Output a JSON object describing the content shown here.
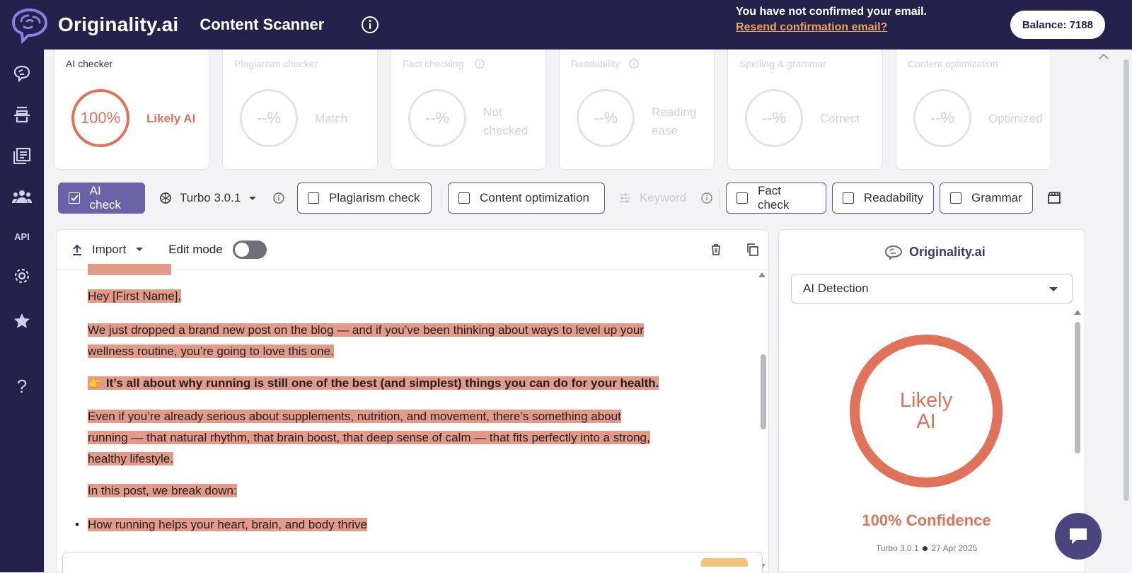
{
  "header": {
    "logo_text": "Originality.ai",
    "app_title": "Content Scanner",
    "email_notice": "You have not confirmed your email.",
    "resend_link": "Resend confirmation email?",
    "balance": "Balance: 7188"
  },
  "sidebar": {
    "items": [
      "brain-icon",
      "scanner-icon",
      "library-icon",
      "team-icon",
      "api-icon",
      "settings-icon",
      "star-icon",
      "help-icon"
    ],
    "api_label": "API",
    "help_label": "?"
  },
  "cards": [
    {
      "title": "AI checker",
      "value": "100%",
      "result": "Likely AI",
      "active": true
    },
    {
      "title": "Plagiarism checker",
      "value": "--%",
      "result": "Match"
    },
    {
      "title": "Fact checking",
      "value": "--%",
      "result_line1": "Not",
      "result_line2": "checked"
    },
    {
      "title": "Readability",
      "value": "--%",
      "result_line1": "Reading",
      "result_line2": "ease"
    },
    {
      "title": "Spelling & grammar",
      "value": "--%",
      "result": "Correct"
    },
    {
      "title": "Content optimization",
      "value": "--%",
      "result": "Optimized"
    }
  ],
  "toolbar": {
    "ai_check": "AI check",
    "model": "Turbo 3.0.1",
    "plagiarism": "Plagiarism check",
    "content_opt": "Content optimization",
    "keyword": "Keyword",
    "fact_check": "Fact check",
    "readability": "Readability",
    "grammar": "Grammar"
  },
  "editor": {
    "import_label": "Import",
    "edit_mode_label": "Edit mode",
    "paragraphs": {
      "greeting": "Hey [First Name],",
      "p1_l1": "We just dropped a brand new post on the blog — and if you’ve been thinking about ways to level up your",
      "p1_l2": "wellness routine, you’re going to love this one.",
      "p2_emoji": "👉",
      "p2_bold": "It’s all about why running is still one of the best (and simplest) things you can do for your health.",
      "p3_l1": "Even if you’re already serious about supplements, nutrition, and movement, there’s something about",
      "p3_l2": "running — that natural rhythm, that brain boost, that deep sense of calm — that fits perfectly into a strong,",
      "p3_l3": "healthy lifestyle.",
      "p4": "In this post, we break down:",
      "bullet1": "How running helps your heart, brain, and body thrive"
    }
  },
  "panel": {
    "brand": "Originality.ai",
    "select_value": "AI Detection",
    "ring_line1": "Likely",
    "ring_line2": "AI",
    "confidence": "100% Confidence",
    "meta_model": "Turbo 3.0.1",
    "meta_date": "27 Apr 2025"
  },
  "colors": {
    "navy": "#24224a",
    "accent": "#e0725a",
    "primary": "#6a63a7",
    "highlight": "#e39a89",
    "link": "#e8a25b"
  }
}
